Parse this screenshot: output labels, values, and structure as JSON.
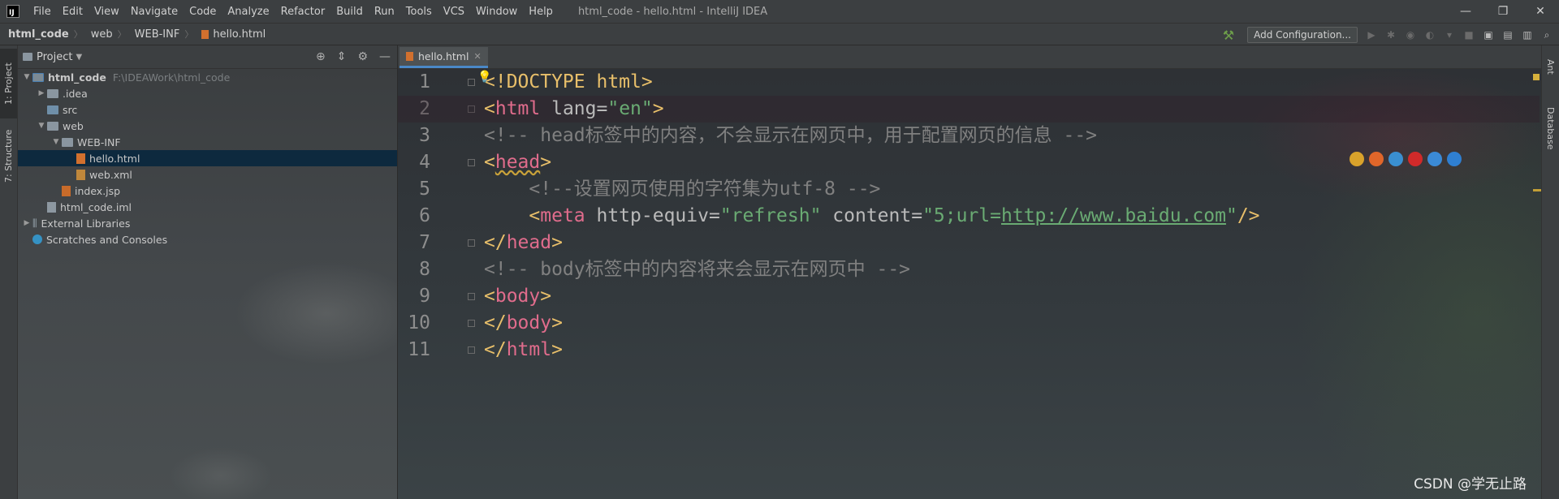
{
  "titlebar": {
    "menus": [
      "File",
      "Edit",
      "View",
      "Navigate",
      "Code",
      "Analyze",
      "Refactor",
      "Build",
      "Run",
      "Tools",
      "VCS",
      "Window",
      "Help"
    ],
    "window_title": "html_code - hello.html - IntelliJ IDEA"
  },
  "navbar": {
    "breadcrumbs": [
      "html_code",
      "web",
      "WEB-INF",
      "hello.html"
    ],
    "add_configuration": "Add Configuration..."
  },
  "tool_windows": {
    "left": [
      "1: Project",
      "7: Structure"
    ],
    "right": [
      "Ant",
      "Database"
    ]
  },
  "project_panel": {
    "title": "Project",
    "tree": [
      {
        "label": "html_code",
        "hint": "F:\\IDEAWork\\html_code",
        "depth": 0,
        "kind": "module",
        "expanded": true
      },
      {
        "label": ".idea",
        "depth": 1,
        "kind": "folder",
        "expanded": false
      },
      {
        "label": "src",
        "depth": 1,
        "kind": "src"
      },
      {
        "label": "web",
        "depth": 1,
        "kind": "folder",
        "expanded": true
      },
      {
        "label": "WEB-INF",
        "depth": 2,
        "kind": "folder",
        "expanded": true
      },
      {
        "label": "hello.html",
        "depth": 3,
        "kind": "html",
        "selected": true
      },
      {
        "label": "web.xml",
        "depth": 3,
        "kind": "xml"
      },
      {
        "label": "index.jsp",
        "depth": 2,
        "kind": "jsp"
      },
      {
        "label": "html_code.iml",
        "depth": 1,
        "kind": "iml"
      },
      {
        "label": "External Libraries",
        "depth": 0,
        "kind": "lib",
        "expanded": false
      },
      {
        "label": "Scratches and Consoles",
        "depth": 0,
        "kind": "scratch"
      }
    ]
  },
  "editor": {
    "tab": "hello.html",
    "current_line": 2,
    "lines": [
      [
        [
          "t-tag",
          "<!DOCTYPE html>"
        ]
      ],
      [
        [
          "t-tag",
          "<"
        ],
        [
          "t-head",
          "html"
        ],
        [
          "t-attr",
          " lang="
        ],
        [
          "t-str",
          "\"en\""
        ],
        [
          "t-tag",
          ">"
        ]
      ],
      [
        [
          "t-cmt",
          "<!-- head标签中的内容，不会显示在网页中，用于配置网页的信息 -->"
        ]
      ],
      [
        [
          "t-tag",
          "<"
        ],
        [
          "t-head t-warn",
          "head"
        ],
        [
          "t-tag",
          ">"
        ]
      ],
      [
        [
          "t-cmt",
          "    <!--设置网页使用的字符集为utf-8 -->"
        ]
      ],
      [
        [
          "t-tag",
          "    <"
        ],
        [
          "t-head",
          "meta"
        ],
        [
          "t-attr",
          " http-equiv="
        ],
        [
          "t-str",
          "\"refresh\""
        ],
        [
          "t-attr",
          " content="
        ],
        [
          "t-str",
          "\"5;url="
        ],
        [
          "t-link",
          "http://www.baidu.com"
        ],
        [
          "t-str",
          "\""
        ],
        [
          "t-tag",
          "/>"
        ]
      ],
      [
        [
          "t-tag",
          "</"
        ],
        [
          "t-head",
          "head"
        ],
        [
          "t-tag",
          ">"
        ]
      ],
      [
        [
          "t-cmt",
          "<!-- body标签中的内容将来会显示在网页中 -->"
        ]
      ],
      [
        [
          "t-tag",
          "<"
        ],
        [
          "t-head",
          "body"
        ],
        [
          "t-tag",
          ">"
        ]
      ],
      [
        [
          "t-tag",
          "</"
        ],
        [
          "t-head",
          "body"
        ],
        [
          "t-tag",
          ">"
        ]
      ],
      [
        [
          "t-tag",
          "</"
        ],
        [
          "t-head",
          "html"
        ],
        [
          "t-tag",
          ">"
        ]
      ]
    ],
    "browser_icons": [
      {
        "name": "chrome-icon",
        "color": "#d9a22b"
      },
      {
        "name": "firefox-icon",
        "color": "#e0662a"
      },
      {
        "name": "safari-icon",
        "color": "#3a8fd0"
      },
      {
        "name": "opera-icon",
        "color": "#d12a2a"
      },
      {
        "name": "ie-icon",
        "color": "#3b8ad6"
      },
      {
        "name": "edge-icon",
        "color": "#2f7fd1"
      }
    ]
  },
  "watermark": "CSDN @学无止路"
}
